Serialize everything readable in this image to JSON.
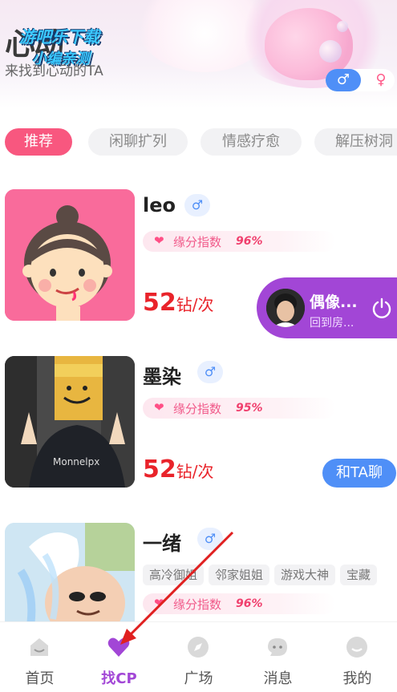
{
  "header": {
    "brand_text": "心动",
    "watermark_line1": "游吧乐下载",
    "watermark_line2": "小编亲测",
    "subtitle": "来找到心动的TA",
    "gender_male_icon": "♂",
    "gender_female_icon": "♀"
  },
  "tabs": [
    {
      "label": "推荐",
      "active": true
    },
    {
      "label": "闲聊扩列",
      "active": false
    },
    {
      "label": "情感疗愈",
      "active": false
    },
    {
      "label": "解压树洞",
      "active": false
    }
  ],
  "affinity_label": "缘分指数",
  "gender_symbol": "♂",
  "cards": [
    {
      "name": "leo",
      "affinity": "96%",
      "price_num": "52",
      "price_unit": "钻/次",
      "chat_label": ""
    },
    {
      "name": "墨染",
      "affinity": "95%",
      "price_num": "52",
      "price_unit": "钻/次",
      "chat_label": "和TA聊"
    },
    {
      "name": "一绪",
      "affinity": "96%",
      "tags": [
        "高冷御姐",
        "邻家姐姐",
        "游戏大神",
        "宝藏"
      ]
    }
  ],
  "room": {
    "title": "偶像...",
    "subtitle": "回到房..."
  },
  "bottom_nav": [
    {
      "label": "首页",
      "icon": "home-icon",
      "active": false
    },
    {
      "label": "找CP",
      "icon": "heart-icon",
      "active": true
    },
    {
      "label": "广场",
      "icon": "compass-icon",
      "active": false
    },
    {
      "label": "消息",
      "icon": "message-icon",
      "active": false
    },
    {
      "label": "我的",
      "icon": "profile-icon",
      "active": false
    }
  ],
  "colors": {
    "accent_pink": "#f8577f",
    "accent_purple": "#a246d6",
    "accent_blue": "#4f8ff7",
    "price_red": "#e9232a"
  }
}
